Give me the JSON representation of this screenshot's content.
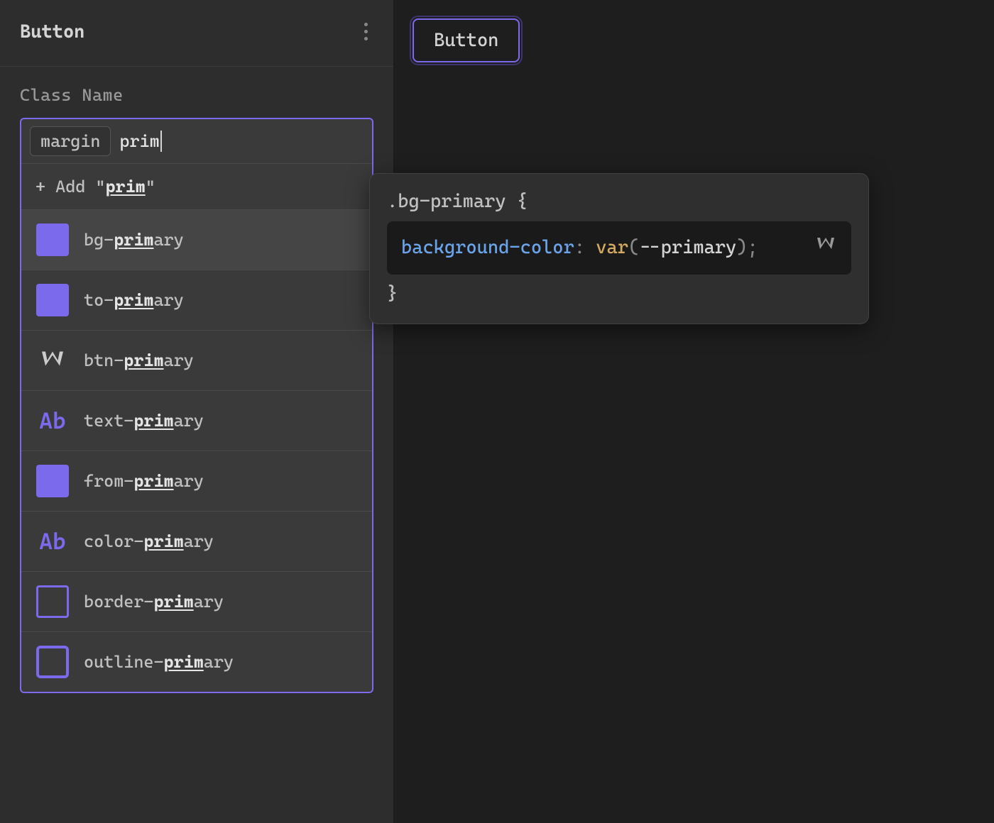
{
  "panel": {
    "title": "Button",
    "field_label": "Class Name",
    "tag": "margin",
    "input_value": "prim",
    "add_prefix": "+ Add \"",
    "add_highlight": "prim",
    "add_suffix": "\"",
    "suggestions": [
      {
        "icon": "swatch-solid",
        "pre": "bg-",
        "hl": "prim",
        "post": "ary",
        "highlighted": true
      },
      {
        "icon": "swatch-solid",
        "pre": "to-",
        "hl": "prim",
        "post": "ary",
        "highlighted": false
      },
      {
        "icon": "brand",
        "pre": "btn-",
        "hl": "prim",
        "post": "ary",
        "highlighted": false
      },
      {
        "icon": "text",
        "pre": "text-",
        "hl": "prim",
        "post": "ary",
        "highlighted": false
      },
      {
        "icon": "swatch-solid",
        "pre": "from-",
        "hl": "prim",
        "post": "ary",
        "highlighted": false
      },
      {
        "icon": "text",
        "pre": "color-",
        "hl": "prim",
        "post": "ary",
        "highlighted": false
      },
      {
        "icon": "swatch-border",
        "pre": "border-",
        "hl": "prim",
        "post": "ary",
        "highlighted": false
      },
      {
        "icon": "swatch-outline",
        "pre": "outline-",
        "hl": "prim",
        "post": "ary",
        "highlighted": false
      }
    ]
  },
  "preview": {
    "button_label": "Button"
  },
  "tooltip": {
    "selector": ".bg-primary {",
    "property": "background-color",
    "colon": ": ",
    "func": "var",
    "paren_open": "(",
    "var_name": "--primary",
    "paren_close": ");",
    "close_brace": "}"
  },
  "colors": {
    "primary": "#7c6aed"
  }
}
